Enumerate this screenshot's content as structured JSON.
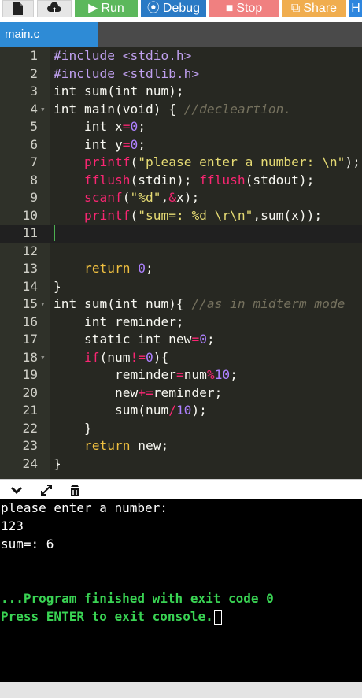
{
  "toolbar": {
    "run_label": "Run",
    "debug_label": "Debug",
    "stop_label": "Stop",
    "share_label": "Share",
    "extra_label": "H",
    "colors": {
      "run": "#5cb85c",
      "debug": "#2a7ac5",
      "stop": "#f08080",
      "share": "#f0ad4e"
    }
  },
  "tab": {
    "label": "main.c"
  },
  "editor": {
    "line_numbers": [
      "1",
      "2",
      "3",
      "4",
      "5",
      "6",
      "7",
      "8",
      "9",
      "10",
      "11",
      "12",
      "13",
      "14",
      "15",
      "16",
      "17",
      "18",
      "19",
      "20",
      "21",
      "22",
      "23",
      "24"
    ],
    "active_line": 11
  },
  "console": {
    "lines": [
      "please enter a number:",
      "123",
      "sum=: 6",
      "",
      "",
      "...Program finished with exit code 0",
      "Press ENTER to exit console."
    ]
  },
  "icons": {
    "toolbar": [
      "file-icon",
      "upload-icon",
      "play-icon",
      "debug-icon",
      "stop-icon",
      "share-icon"
    ],
    "console_bar": [
      "chevron-down-icon",
      "expand-icon",
      "clear-console-icon"
    ]
  }
}
